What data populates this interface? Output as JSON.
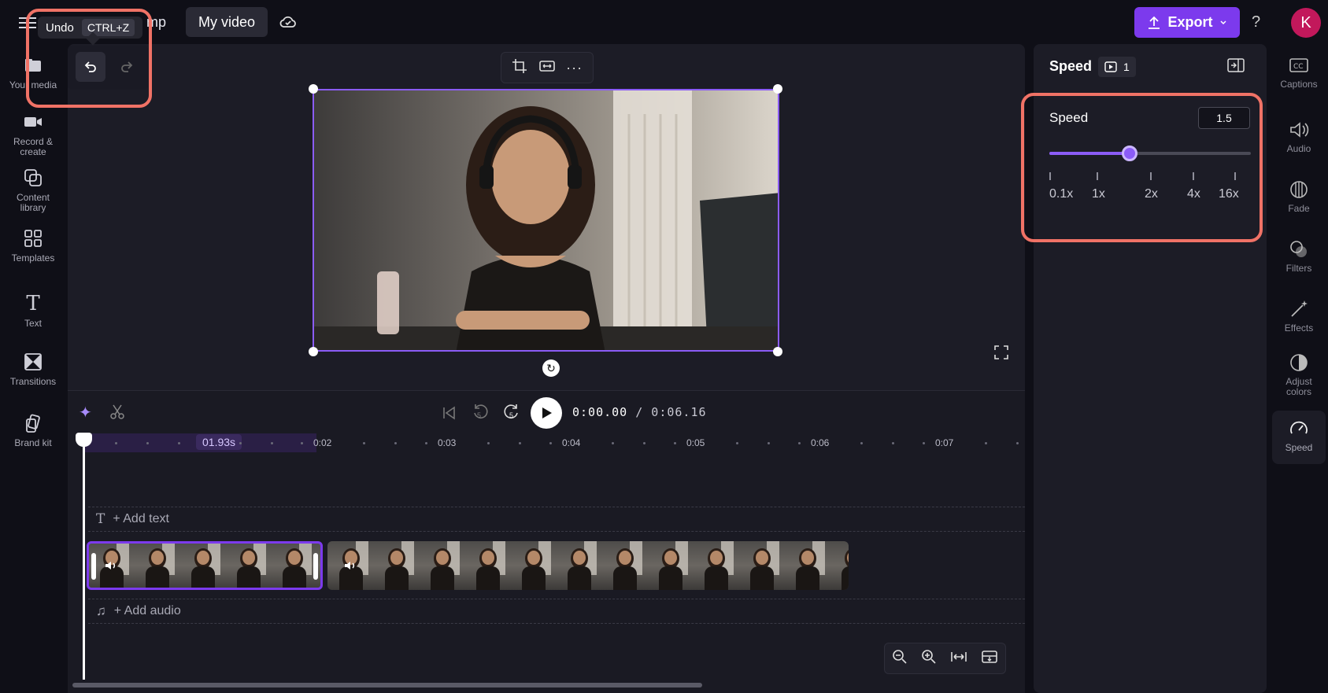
{
  "topbar": {
    "tooltip_action": "Undo",
    "tooltip_shortcut": "CTRL+Z",
    "title_fragment": "mp",
    "project_name": "My video",
    "export_label": "Export",
    "help_label": "?",
    "avatar_initial": "K"
  },
  "left_sidebar": {
    "items": [
      {
        "label": "Your media",
        "icon": "folder-icon"
      },
      {
        "label": "Record & create",
        "icon": "camera-icon"
      },
      {
        "label": "Content library",
        "icon": "content-library-icon"
      },
      {
        "label": "Templates",
        "icon": "templates-icon"
      },
      {
        "label": "Text",
        "icon": "text-icon"
      },
      {
        "label": "Transitions",
        "icon": "transitions-icon"
      },
      {
        "label": "Brand kit",
        "icon": "brand-kit-icon"
      }
    ]
  },
  "right_sidebar": {
    "items": [
      {
        "label": "Captions",
        "icon": "captions-icon"
      },
      {
        "label": "Audio",
        "icon": "speaker-icon"
      },
      {
        "label": "Fade",
        "icon": "fade-icon"
      },
      {
        "label": "Filters",
        "icon": "filters-icon"
      },
      {
        "label": "Effects",
        "icon": "effects-icon"
      },
      {
        "label": "Adjust colors",
        "icon": "adjust-colors-icon"
      },
      {
        "label": "Speed",
        "icon": "speedometer-icon",
        "active": true
      }
    ]
  },
  "timeline": {
    "current_time": "0:00.00",
    "total_time": "/ 0:06.16",
    "selection_badge": "01.93s",
    "ruler_labels": [
      "0:02",
      "0:03",
      "0:04",
      "0:05",
      "0:06",
      "0:07"
    ],
    "add_text": "+ Add text",
    "add_audio": "+ Add audio",
    "skip_back": "5",
    "skip_forward": "5"
  },
  "properties": {
    "panel_title": "Speed",
    "clip_count": "1",
    "speed_label": "Speed",
    "speed_value": "1.5",
    "slider_fraction": 0.4,
    "slider_labels": [
      "0.1x",
      "1x",
      "2x",
      "4x",
      "16x"
    ]
  },
  "colors": {
    "accent": "#7c3aed",
    "highlight": "#f07266",
    "background": "#0f0f17"
  }
}
